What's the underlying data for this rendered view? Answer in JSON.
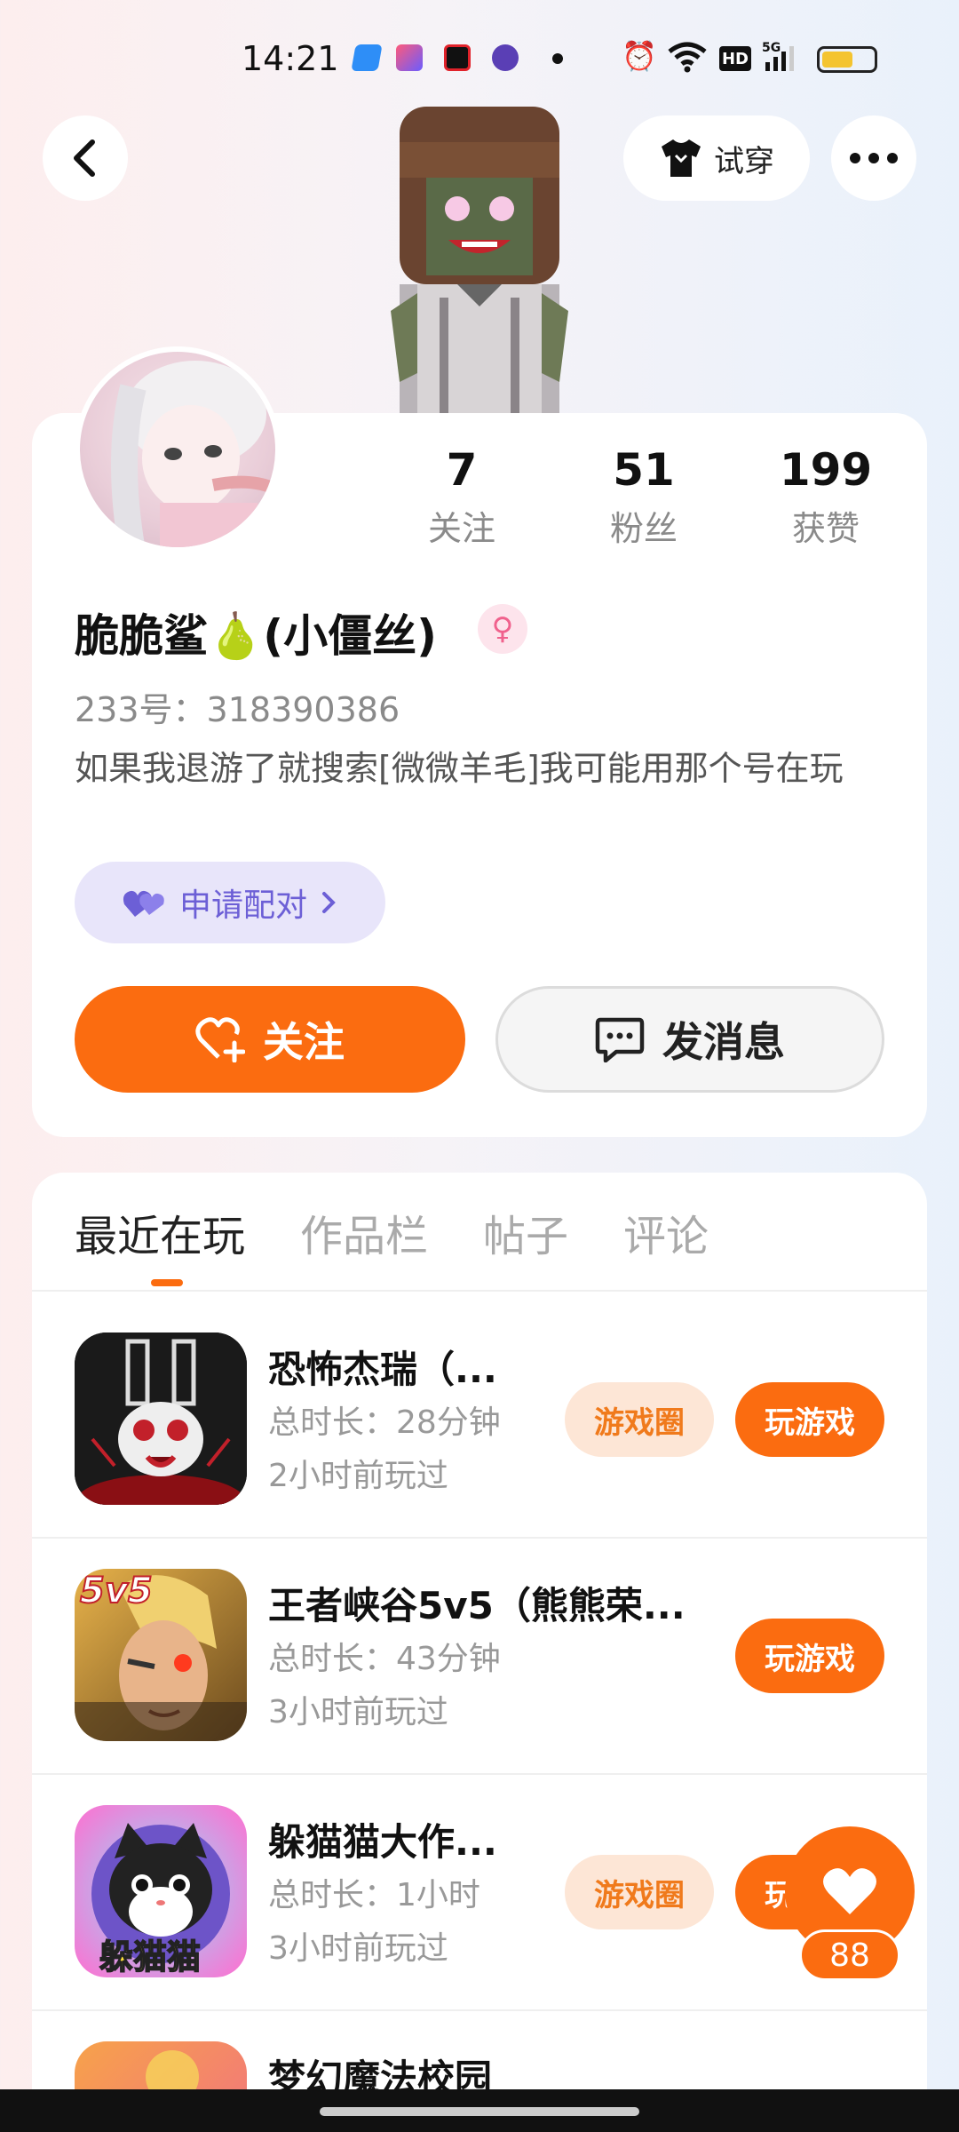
{
  "status_bar": {
    "time": "14:21",
    "icons": [
      "app-icon-blue",
      "app-icon-shortcut",
      "record-icon",
      "vpn-icon",
      "dot-icon",
      "alarm-icon",
      "wifi-icon",
      "hd-icon",
      "signal-5g-icon",
      "battery-icon"
    ],
    "battery_level": 0.6
  },
  "header": {
    "tryon_label": "试穿"
  },
  "profile": {
    "stats": [
      {
        "value": "7",
        "label": "关注"
      },
      {
        "value": "51",
        "label": "粉丝"
      },
      {
        "value": "199",
        "label": "获赞"
      }
    ],
    "username": "脆脆鲨🍐(小僵丝)",
    "gender_symbol": "♀",
    "uid": "233号：318390386",
    "bio": "如果我退游了就搜索[微微羊毛]我可能用那个号在玩",
    "pair_label": "申请配对",
    "follow_label": "关注",
    "message_label": "发消息"
  },
  "tabs": [
    "最近在玩",
    "作品栏",
    "帖子",
    "评论"
  ],
  "games": [
    {
      "title": "恐怖杰瑞（...",
      "duration": "总时长：28分钟",
      "last_played": "2小时前玩过",
      "circle_label": "游戏圈",
      "play_label": "玩游戏"
    },
    {
      "title": "王者峡谷5v5（熊熊荣...",
      "duration": "总时长：43分钟",
      "last_played": "3小时前玩过",
      "play_label": "玩游戏",
      "icon_badge": "5v5"
    },
    {
      "title": "躲猫猫大作...",
      "duration": "总时长：1小时",
      "last_played": "3小时前玩过",
      "circle_label": "游戏圈",
      "play_label": "玩游戏",
      "icon_badge": "躲猫猫"
    },
    {
      "title": "梦幻魔法校园"
    }
  ],
  "like_fab": {
    "count": "88"
  },
  "colors": {
    "accent": "#fb6c10",
    "pair": "#6c5fd6",
    "pair_bg": "#e8e5fa"
  }
}
